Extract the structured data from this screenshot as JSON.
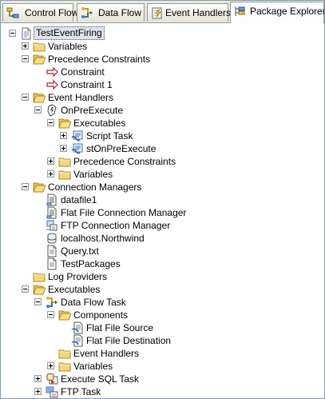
{
  "tabs": [
    {
      "label": "Control Flow",
      "icon": "control-flow-icon",
      "active": false
    },
    {
      "label": "Data Flow",
      "icon": "data-flow-icon",
      "active": false
    },
    {
      "label": "Event Handlers",
      "icon": "event-handlers-icon",
      "active": false
    },
    {
      "label": "Package Explorer",
      "icon": "package-explorer-icon",
      "active": true
    }
  ],
  "tree": [
    {
      "label": "TestEventFiring",
      "level": 0,
      "expander": "minus",
      "icon": "package",
      "selected": true
    },
    {
      "label": "Variables",
      "level": 1,
      "expander": "plus",
      "icon": "folder"
    },
    {
      "label": "Precedence Constraints",
      "level": 1,
      "expander": "minus",
      "icon": "folder-open"
    },
    {
      "label": "Constraint",
      "level": 2,
      "expander": "none",
      "icon": "arrow"
    },
    {
      "label": "Constraint 1",
      "level": 2,
      "expander": "none",
      "icon": "arrow"
    },
    {
      "label": "Event Handlers",
      "level": 1,
      "expander": "minus",
      "icon": "folder-open"
    },
    {
      "label": "OnPreExecute",
      "level": 2,
      "expander": "minus",
      "icon": "event"
    },
    {
      "label": "Executables",
      "level": 3,
      "expander": "minus",
      "icon": "folder-open"
    },
    {
      "label": "Script Task",
      "level": 4,
      "expander": "plus",
      "icon": "script"
    },
    {
      "label": "stOnPreExecute",
      "level": 4,
      "expander": "plus",
      "icon": "script"
    },
    {
      "label": "Precedence Constraints",
      "level": 3,
      "expander": "plus",
      "icon": "folder"
    },
    {
      "label": "Variables",
      "level": 3,
      "expander": "plus",
      "icon": "folder"
    },
    {
      "label": "Connection Managers",
      "level": 1,
      "expander": "minus",
      "icon": "folder-open"
    },
    {
      "label": "datafile1",
      "level": 2,
      "expander": "none",
      "icon": "flatfile"
    },
    {
      "label": "Flat File Connection Manager",
      "level": 2,
      "expander": "none",
      "icon": "flatfile"
    },
    {
      "label": "FTP Connection Manager",
      "level": 2,
      "expander": "none",
      "icon": "ftpconn"
    },
    {
      "label": "localhost.Northwind",
      "level": 2,
      "expander": "none",
      "icon": "oledb"
    },
    {
      "label": "Query.txt",
      "level": 2,
      "expander": "none",
      "icon": "file"
    },
    {
      "label": "TestPackages",
      "level": 2,
      "expander": "none",
      "icon": "file"
    },
    {
      "label": "Log Providers",
      "level": 1,
      "expander": "none",
      "icon": "folder"
    },
    {
      "label": "Executables",
      "level": 1,
      "expander": "minus",
      "icon": "folder-open"
    },
    {
      "label": "Data Flow Task",
      "level": 2,
      "expander": "minus",
      "icon": "dataflow"
    },
    {
      "label": "Components",
      "level": 3,
      "expander": "minus",
      "icon": "folder-open"
    },
    {
      "label": "Flat File Source",
      "level": 4,
      "expander": "none",
      "icon": "component"
    },
    {
      "label": "Flat File Destination",
      "level": 4,
      "expander": "none",
      "icon": "component"
    },
    {
      "label": "Event Handlers",
      "level": 3,
      "expander": "none",
      "icon": "folder"
    },
    {
      "label": "Variables",
      "level": 3,
      "expander": "plus",
      "icon": "folder"
    },
    {
      "label": "Execute SQL Task",
      "level": 2,
      "expander": "plus",
      "icon": "sqltask"
    },
    {
      "label": "FTP Task",
      "level": 2,
      "expander": "plus",
      "icon": "ftptask"
    }
  ]
}
